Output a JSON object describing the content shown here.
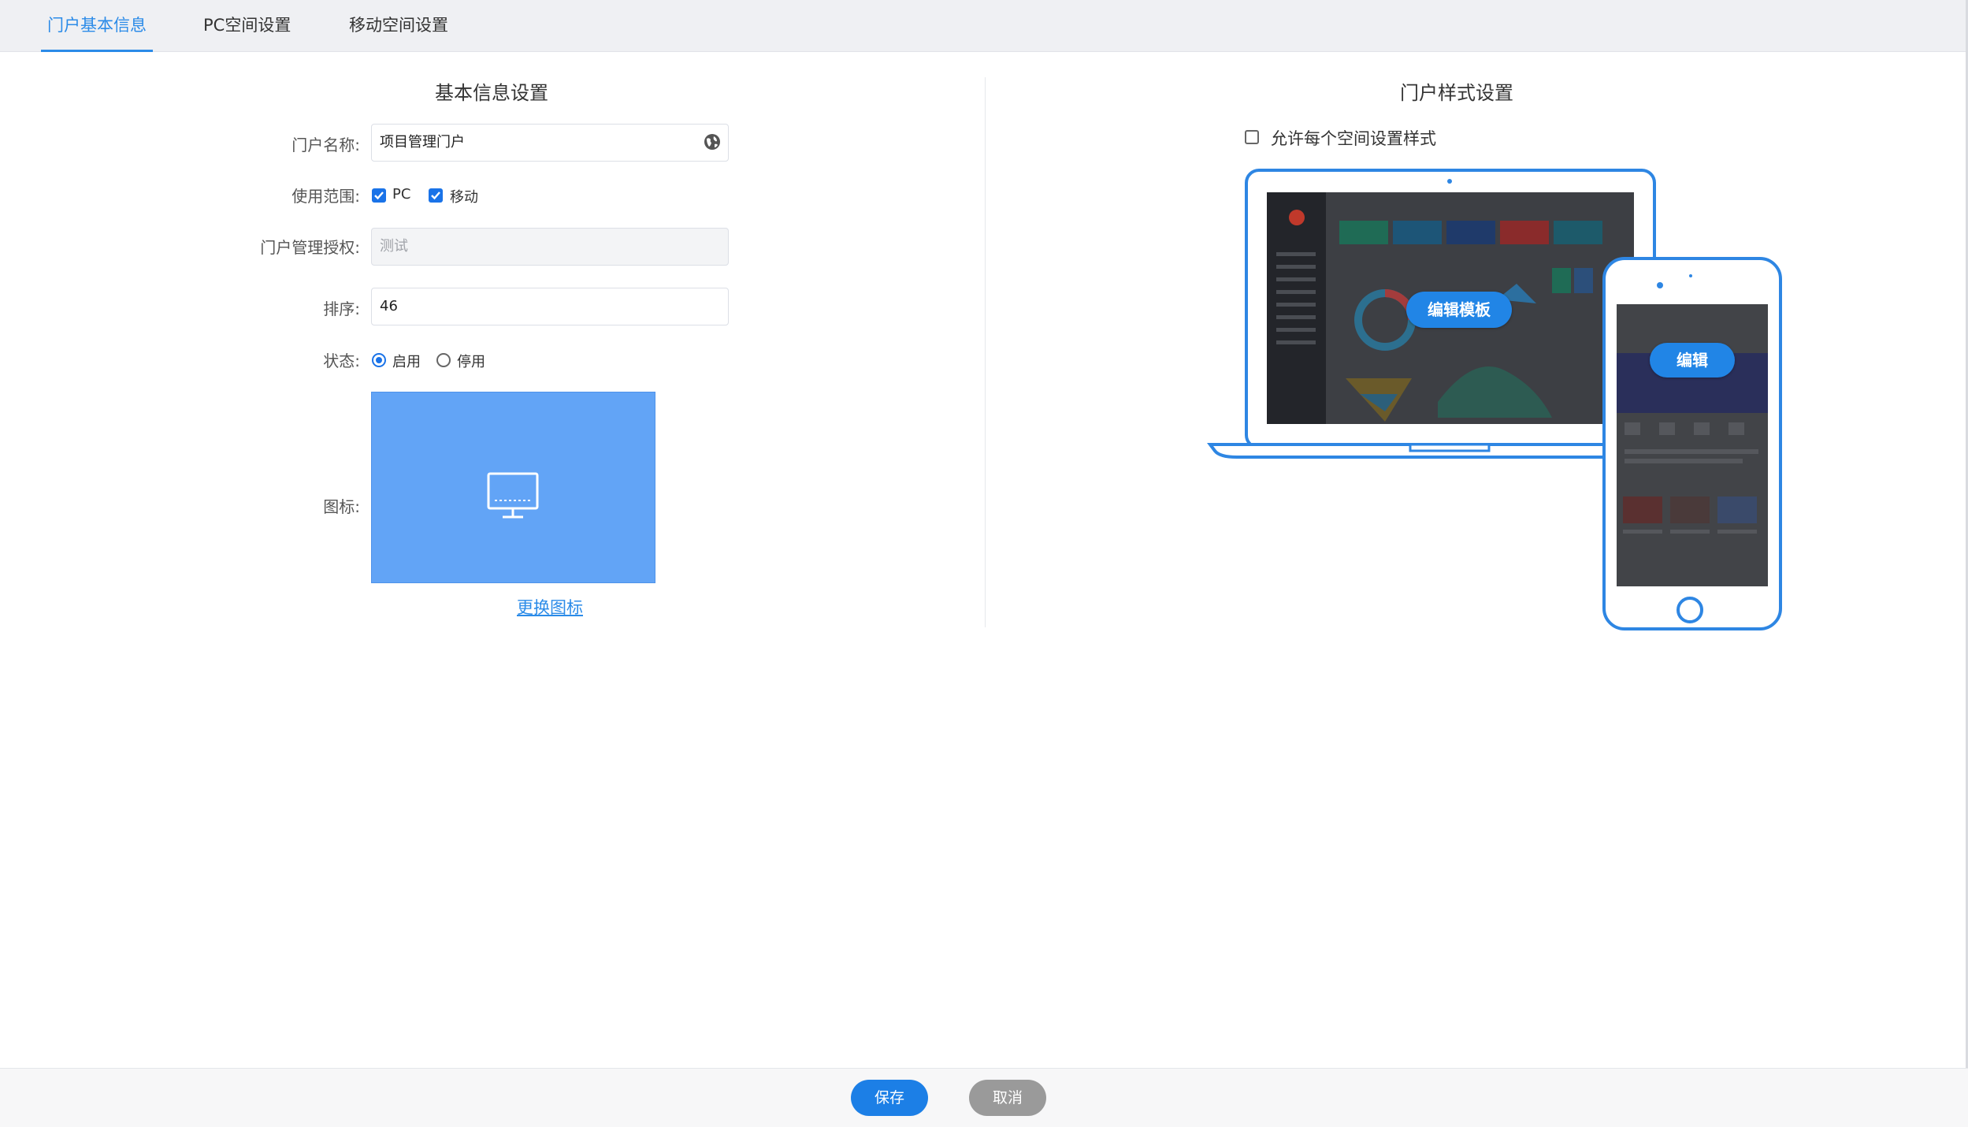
{
  "tabs": [
    {
      "label": "门户基本信息",
      "active": true
    },
    {
      "label": "PC空间设置",
      "active": false
    },
    {
      "label": "移动空间设置",
      "active": false
    }
  ],
  "basic": {
    "title": "基本信息设置",
    "name_label": "门户名称:",
    "name_value": "项目管理门户",
    "scope_label": "使用范围:",
    "scope_options": [
      {
        "label": "PC",
        "checked": true
      },
      {
        "label": "移动",
        "checked": true
      }
    ],
    "auth_label": "门户管理授权:",
    "auth_placeholder": "测试",
    "order_label": "排序:",
    "order_value": "46",
    "status_label": "状态:",
    "status_options": [
      {
        "label": "启用",
        "selected": true
      },
      {
        "label": "停用",
        "selected": false
      }
    ],
    "icon_label": "图标:",
    "icon_name": "monitor-icon",
    "change_icon_link": "更换图标"
  },
  "style": {
    "title": "门户样式设置",
    "allow_per_space_label": "允许每个空间设置样式",
    "allow_per_space_checked": false,
    "edit_template_button": "编辑模板",
    "edit_mobile_button": "编辑"
  },
  "footer": {
    "save_label": "保存",
    "cancel_label": "取消"
  },
  "colors": {
    "accent": "#2b8be8",
    "icon_bg": "#62a4f6",
    "device_frame": "#2e86e3"
  }
}
